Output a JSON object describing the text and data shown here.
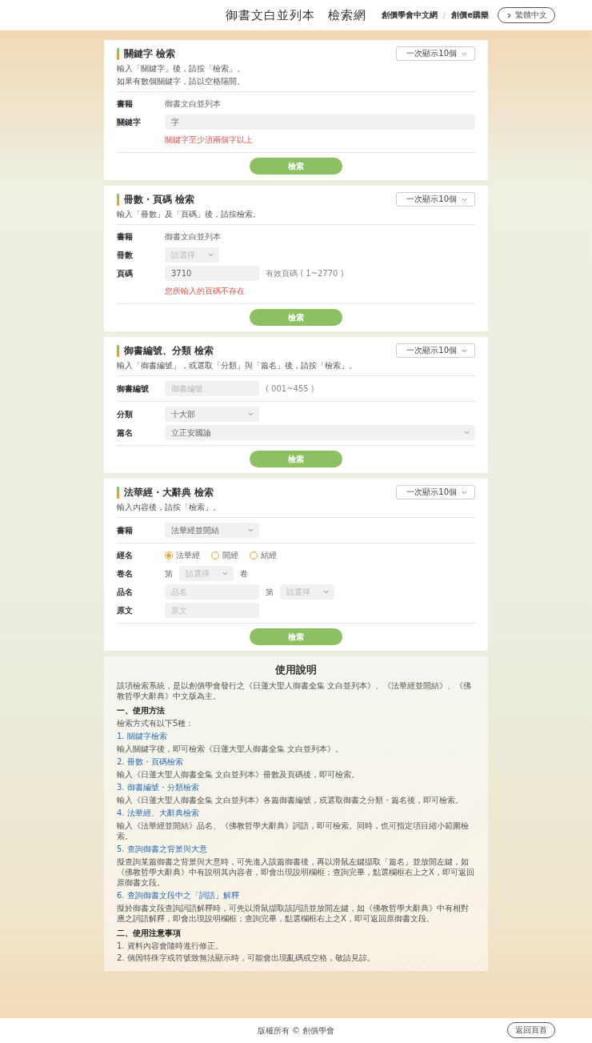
{
  "header": {
    "title": "御書文白並列本　檢索網",
    "links": [
      "創價學會中文網",
      "創價e購樂"
    ],
    "separator": "/",
    "language_button": "繁體中文"
  },
  "sections": [
    {
      "title": "關鍵字 檢索",
      "per_page": "一次顯示10個",
      "description": [
        "輸入「關鍵字」後，請按「檢索」。",
        "如果有數個關鍵字，請以空格隔開。"
      ],
      "groups": [
        {
          "rows": [
            {
              "kind": "text",
              "label": "書籍",
              "value": "御書文白並列本"
            },
            {
              "kind": "wide_input",
              "label": "關鍵字",
              "value": "字"
            },
            {
              "kind": "error",
              "message": "關鍵字至少須兩個字以上"
            }
          ]
        }
      ],
      "button": "檢索"
    },
    {
      "title": "冊數・頁碼 檢索",
      "per_page": "一次顯示10個",
      "description": [
        "輸入「冊數」及「頁碼」後，請按檢索。"
      ],
      "groups": [
        {
          "rows": [
            {
              "kind": "text",
              "label": "書籍",
              "value": "御書文白並列本"
            },
            {
              "kind": "short_select",
              "label": "冊數",
              "placeholder": "請選擇"
            },
            {
              "kind": "input",
              "label": "頁碼",
              "value": "3710",
              "hint": "有效頁碼 ( 1~2770 )"
            },
            {
              "kind": "error",
              "message": "您所輸入的頁碼不存在"
            }
          ]
        }
      ],
      "button": "檢索"
    },
    {
      "title": "御書編號、分類 檢索",
      "per_page": "一次顯示10個",
      "description": [
        "輸入「御書編號」，或選取「分類」與「篇名」後，請按「檢索」。"
      ],
      "groups": [
        {
          "rows": [
            {
              "kind": "input",
              "label": "御書編號",
              "placeholder": "御書編號",
              "hint": "( 001~455 )"
            }
          ]
        },
        {
          "rows": [
            {
              "kind": "select",
              "label": "分類",
              "value": "十大部"
            },
            {
              "kind": "wide_select",
              "label": "篇名",
              "value": "立正安國論"
            }
          ]
        }
      ],
      "button": "檢索"
    },
    {
      "title": "法華經・大辭典 檢索",
      "per_page": "一次顯示10個",
      "description": [
        "輸入內容後，請按「檢索」。"
      ],
      "groups": [
        {
          "rows": [
            {
              "kind": "select",
              "label": "書籍",
              "value": "法華經並開結"
            }
          ]
        },
        {
          "rows": [
            {
              "kind": "radio",
              "label": "經名",
              "options": [
                {
                  "label": "法華經",
                  "selected": true
                },
                {
                  "label": "開經",
                  "selected": false
                },
                {
                  "label": "結經",
                  "selected": false
                }
              ]
            },
            {
              "kind": "volume",
              "label": "卷名",
              "prefix": "第",
              "placeholder": "請選擇",
              "suffix": "卷"
            },
            {
              "kind": "input_select",
              "label": "品名",
              "placeholder": "品名",
              "prefix": "第",
              "select_placeholder": "請選擇"
            },
            {
              "kind": "input",
              "label": "原文",
              "placeholder": "原文"
            }
          ]
        }
      ],
      "button": "檢索"
    }
  ],
  "usage": {
    "title": "使用說明",
    "intro": "該項檢索系統，是以創價學會發行之《日蓮大聖人御書全集 文白並列本》、《法華經並開結》、《佛教哲學大辭典》中文版為主。",
    "method_heading": "一、使用方法",
    "method_lead": "檢索方式有以下5種：",
    "methods": [
      {
        "title": "1. 關鍵字檢索",
        "body": "輸入關鍵字後，即可檢索《日蓮大聖人御書全集 文白並列本》。"
      },
      {
        "title": "2. 冊數・頁碼檢索",
        "body": "輸入《日蓮大聖人御書全集 文白並列本》冊數及頁碼後，即可檢索。"
      },
      {
        "title": "3. 御書編號・分類檢索",
        "body": "輸入《日蓮大聖人御書全集 文白並列本》各篇御書編號，或選取御書之分類・篇名後，即可檢索。"
      },
      {
        "title": "4. 法華經、大辭典檢索",
        "body": "輸入《法華經並開結》品名、《佛教哲學大辭典》詞語，即可檢索。同時，也可指定項目縮小範圍檢索。"
      },
      {
        "title": "5. 查詢御書之背景與大意",
        "body": "擬查詢某篇御書之背景與大意時，可先進入該篇御書後，再以滑鼠左鍵擷取「篇名」並放開左鍵，如《佛教哲學大辭典》中有說明其內容者，即會出現說明欄框；查詢完畢，點選欄框右上之X，即可返回原御書文段。"
      },
      {
        "title": "6. 查詢御書文段中之「詞語」解釋",
        "body": "擬於御書文段查詢詞語解釋時，可先以滑鼠擷取該詞語並放開左鍵，如《佛教哲學大辭典》中有相對應之詞語解釋，即會出現說明欄框；查詢完畢，點選欄框右上之X，即可返回原御書文段。"
      }
    ],
    "notes_heading": "二、使用注意事項",
    "notes": [
      "1. 資料內容會隨時進行修正。",
      "2. 倘因特殊字或符號致無法顯示時，可能會出現亂碼或空格，敬請見諒。"
    ]
  },
  "footer": {
    "copyright": "版權所有 © 創價學會",
    "top_button": "返回頁首"
  }
}
